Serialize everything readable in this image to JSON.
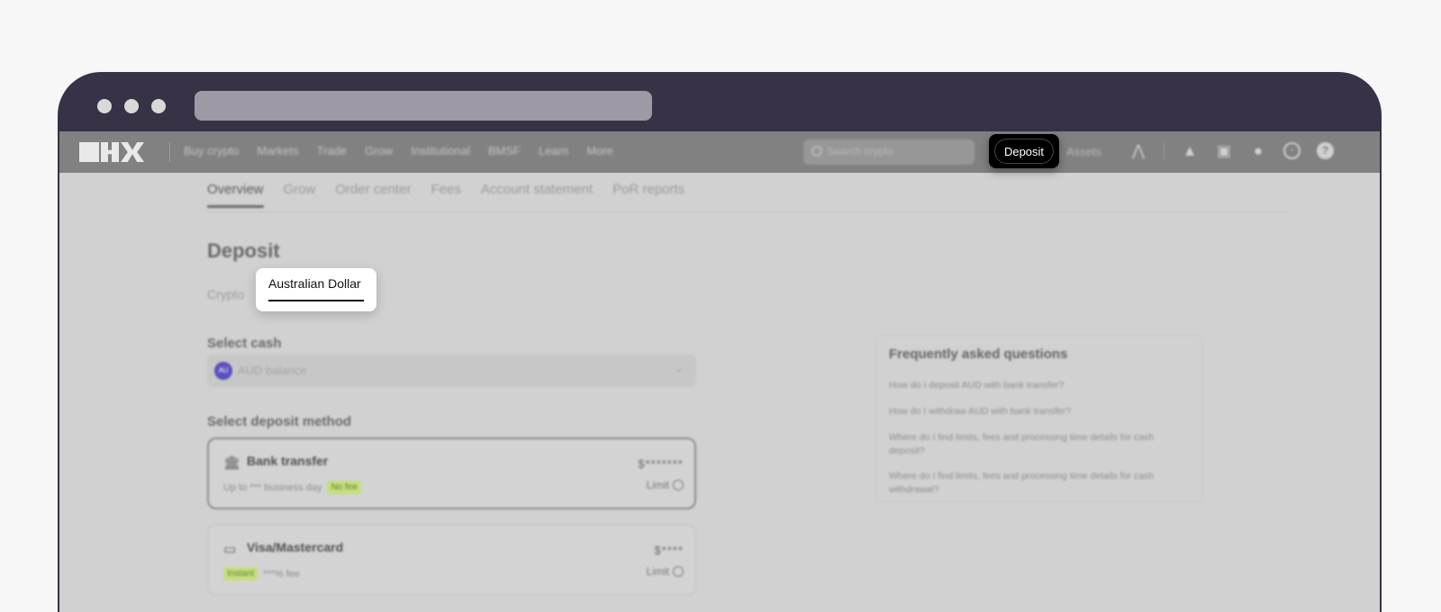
{
  "nav": {
    "links": [
      "Buy crypto",
      "Markets",
      "Trade",
      "Grow",
      "Institutional",
      "BMSF",
      "Learn",
      "More"
    ],
    "search_placeholder": "Search crypto",
    "deposit_label": "Deposit",
    "assets_label": "Assets"
  },
  "tabs": [
    "Overview",
    "Grow",
    "Order center",
    "Fees",
    "Account statement",
    "PoR reports"
  ],
  "page": {
    "title": "Deposit",
    "subtab_crypto": "Crypto",
    "subtab_aud": "Australian Dollar"
  },
  "select_cash": {
    "label": "Select cash",
    "coin": "AU",
    "value": "AUD balance"
  },
  "deposit_method": {
    "label": "Select deposit method",
    "methods": [
      {
        "name": "Bank transfer",
        "sub": "Up to *** business day",
        "badge": "No fee",
        "value": "$*******",
        "limit": "Limit"
      },
      {
        "name": "Visa/Mastercard",
        "sub": "***% fee",
        "badge": "Instant",
        "value": "$****",
        "limit": "Limit"
      }
    ]
  },
  "faq": {
    "title": "Frequently asked questions",
    "questions": [
      "How do I deposit AUD with bank transfer?",
      "How do I withdraw AUD with bank transfer?",
      "Where do I find limits, fees and processing time details for cash deposit?",
      "Where do I find limits, fees and processing time details for cash withdrawal?"
    ]
  },
  "colors": {
    "browser_frame": "#373246",
    "highlight_bg": "#000000",
    "badge_green": "#c4e07c"
  }
}
